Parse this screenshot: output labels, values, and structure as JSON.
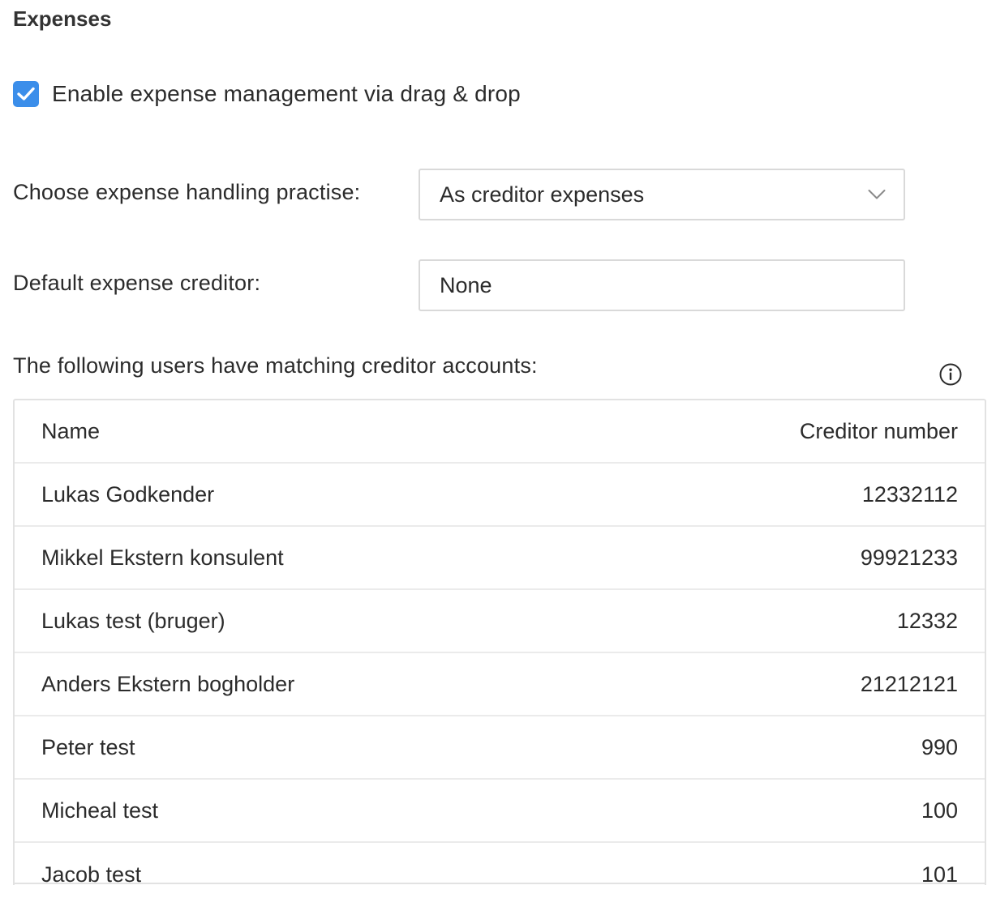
{
  "section": {
    "title": "Expenses"
  },
  "checkbox": {
    "label": "Enable expense management via drag & drop",
    "checked": true,
    "color": "#3b8eea"
  },
  "handling": {
    "label": "Choose expense handling practise:",
    "value": "As creditor expenses",
    "icon": "chevron-down-icon"
  },
  "default_creditor": {
    "label": "Default expense creditor:",
    "value": "None"
  },
  "users_table": {
    "intro": "The following users have matching creditor accounts:",
    "info_icon": "info-icon",
    "columns": {
      "name": "Name",
      "creditor_number": "Creditor number"
    },
    "rows": [
      {
        "name": "Lukas Godkender",
        "creditor_number": "12332112"
      },
      {
        "name": "Mikkel Ekstern konsulent",
        "creditor_number": "99921233"
      },
      {
        "name": "Lukas test (bruger)",
        "creditor_number": "12332"
      },
      {
        "name": "Anders Ekstern bogholder",
        "creditor_number": "21212121"
      },
      {
        "name": "Peter test",
        "creditor_number": "990"
      },
      {
        "name": "Micheal test",
        "creditor_number": "100"
      },
      {
        "name": "Jacob test",
        "creditor_number": "101"
      }
    ]
  }
}
